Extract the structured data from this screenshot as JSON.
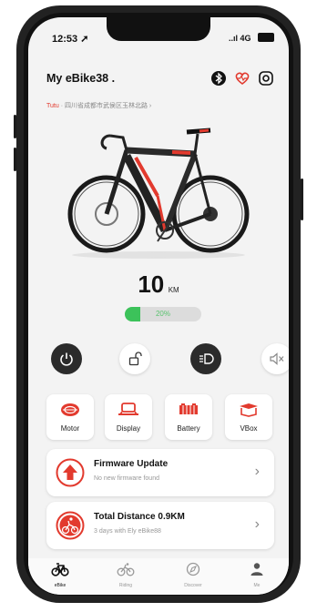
{
  "status_bar": {
    "time": "12:53 ➚",
    "signal": "..ıl 4G",
    "battery": ""
  },
  "header": {
    "title": "My eBike38 .",
    "icons": [
      "bluetooth-icon",
      "heart-rate-icon",
      "settings-icon"
    ]
  },
  "location": {
    "prefix": "Tutu",
    "text": "· 四川省成都市武侯区玉林北路 ›"
  },
  "range": {
    "value": "10",
    "unit": "KM"
  },
  "battery": {
    "percent": 20,
    "label": "20%"
  },
  "controls": [
    {
      "name": "power",
      "icon": "power-icon",
      "active": true
    },
    {
      "name": "lock",
      "icon": "unlock-icon",
      "active": false
    },
    {
      "name": "light",
      "icon": "headlight-icon",
      "active": true
    },
    {
      "name": "mute",
      "icon": "speaker-mute-icon",
      "active": false
    }
  ],
  "cards": [
    {
      "label": "Motor",
      "icon": "motor-icon"
    },
    {
      "label": "Display",
      "icon": "display-icon"
    },
    {
      "label": "Battery",
      "icon": "battery-icon"
    },
    {
      "label": "VBox",
      "icon": "vbox-icon"
    }
  ],
  "rows": [
    {
      "title": "Firmware Update",
      "subtitle": "No new firmware found",
      "icon": "upload-arrow-icon"
    },
    {
      "title": "Total Distance 0.9KM",
      "subtitle": "3 days with Ely eBike88",
      "icon": "cyclist-icon"
    }
  ],
  "tabs": [
    {
      "label": "eBike",
      "icon": "bike-icon",
      "active": true
    },
    {
      "label": "Riding",
      "icon": "riding-icon",
      "active": false
    },
    {
      "label": "Discover",
      "icon": "compass-icon",
      "active": false
    },
    {
      "label": "Me",
      "icon": "person-icon",
      "active": false
    }
  ],
  "colors": {
    "accent": "#e23a2e",
    "battery_green": "#3cc25a",
    "dark": "#2b2b2b"
  }
}
